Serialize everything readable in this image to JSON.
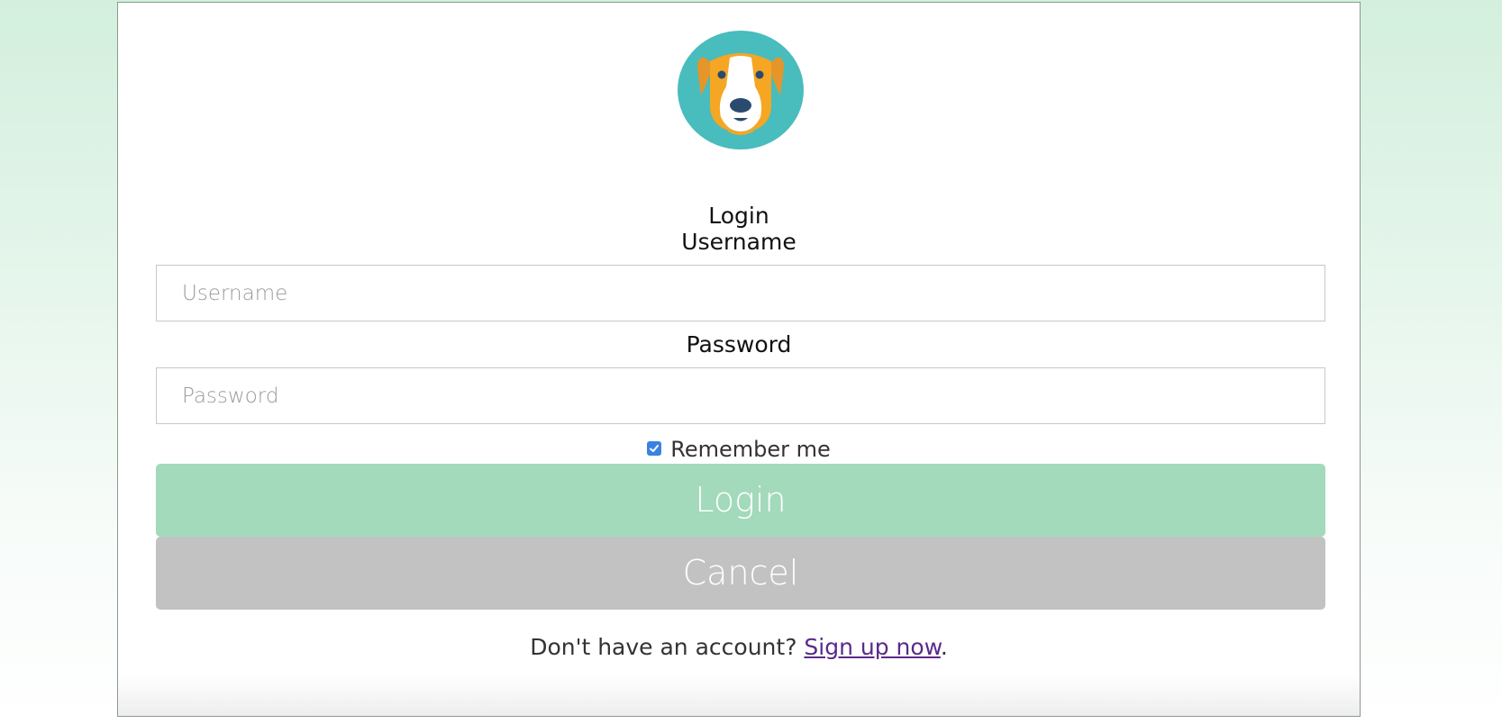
{
  "form": {
    "title": "Login",
    "username_label": "Username",
    "username_placeholder": "Username",
    "password_label": "Password",
    "password_placeholder": "Password",
    "remember_label": "Remember me",
    "remember_checked": true,
    "login_button": "Login",
    "cancel_button": "Cancel",
    "signup_prompt": "Don't have an account? ",
    "signup_link": "Sign up now",
    "signup_suffix": "."
  },
  "icons": {
    "avatar": "dog-avatar-icon",
    "checkbox": "checkbox-checked-icon"
  },
  "colors": {
    "login_button_bg": "#a2dabb",
    "cancel_button_bg": "#c2c2c2",
    "avatar_circle": "#49bcbd",
    "dog_orange": "#f5a623",
    "link": "#5a2a8a"
  }
}
